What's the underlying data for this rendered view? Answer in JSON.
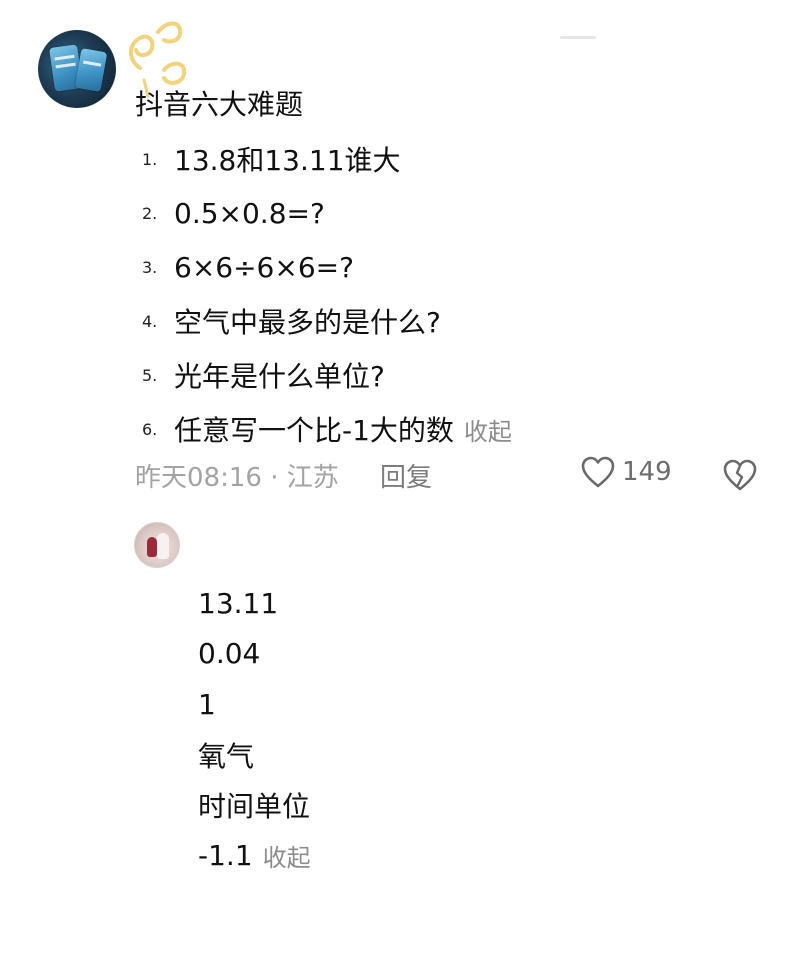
{
  "post": {
    "title": "抖音六大难题",
    "questions": [
      {
        "num": "1.",
        "text": "13.8和13.11谁大"
      },
      {
        "num": "2.",
        "text": "0.5×0.8=?"
      },
      {
        "num": "3.",
        "text": "6×6÷6×6=?"
      },
      {
        "num": "4.",
        "text": "空气中最多的是什么?"
      },
      {
        "num": "5.",
        "text": "光年是什么单位?"
      },
      {
        "num": "6.",
        "text": "任意写一个比-1大的数"
      }
    ],
    "collapse_label": "收起",
    "meta": "昨天08:16 · 江苏",
    "reply_label": "回复",
    "like_count": "149",
    "icons": {
      "like": "heart-outline-icon",
      "dislike": "broken-heart-icon"
    }
  },
  "reply": {
    "answers": [
      "13.11",
      "0.04",
      "1",
      "氧气",
      "时间单位",
      "-1.1"
    ],
    "collapse_label": "收起"
  }
}
